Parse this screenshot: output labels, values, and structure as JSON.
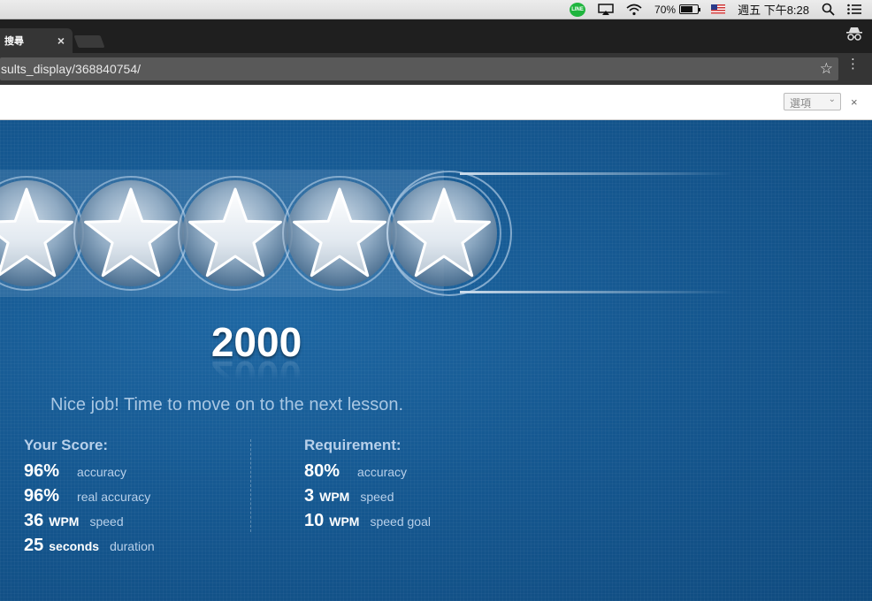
{
  "menubar": {
    "line_label": "LINE",
    "battery_percent": "70%",
    "battery_level": 0.7,
    "clock": "週五 下午8:28"
  },
  "tab": {
    "title": "搜尋",
    "close": "×"
  },
  "omnibox": {
    "url": "sults_display/368840754/",
    "star": "☆",
    "menu": "⋮"
  },
  "infobar": {
    "options_label": "選項",
    "close": "×"
  },
  "results": {
    "stars_earned": 5,
    "stars_total": 5,
    "score": "2000",
    "message": "Nice job! Time to move on to the next lesson.",
    "your_score": {
      "heading": "Your Score:",
      "rows": [
        {
          "value": "96%",
          "unit": "",
          "label": "accuracy"
        },
        {
          "value": "96%",
          "unit": "",
          "label": "real accuracy"
        },
        {
          "value": "36",
          "unit": "WPM",
          "label": "speed"
        },
        {
          "value": "25",
          "unit": "seconds",
          "label": "duration"
        }
      ]
    },
    "requirement": {
      "heading": "Requirement:",
      "rows": [
        {
          "value": "80%",
          "unit": "",
          "label": "accuracy"
        },
        {
          "value": "3",
          "unit": "WPM",
          "label": "speed"
        },
        {
          "value": "10",
          "unit": "WPM",
          "label": "speed goal"
        }
      ]
    }
  },
  "colors": {
    "panel_blue": "#155891",
    "heading_text": "#b8d0ea",
    "message_text": "#a9c7e3"
  }
}
